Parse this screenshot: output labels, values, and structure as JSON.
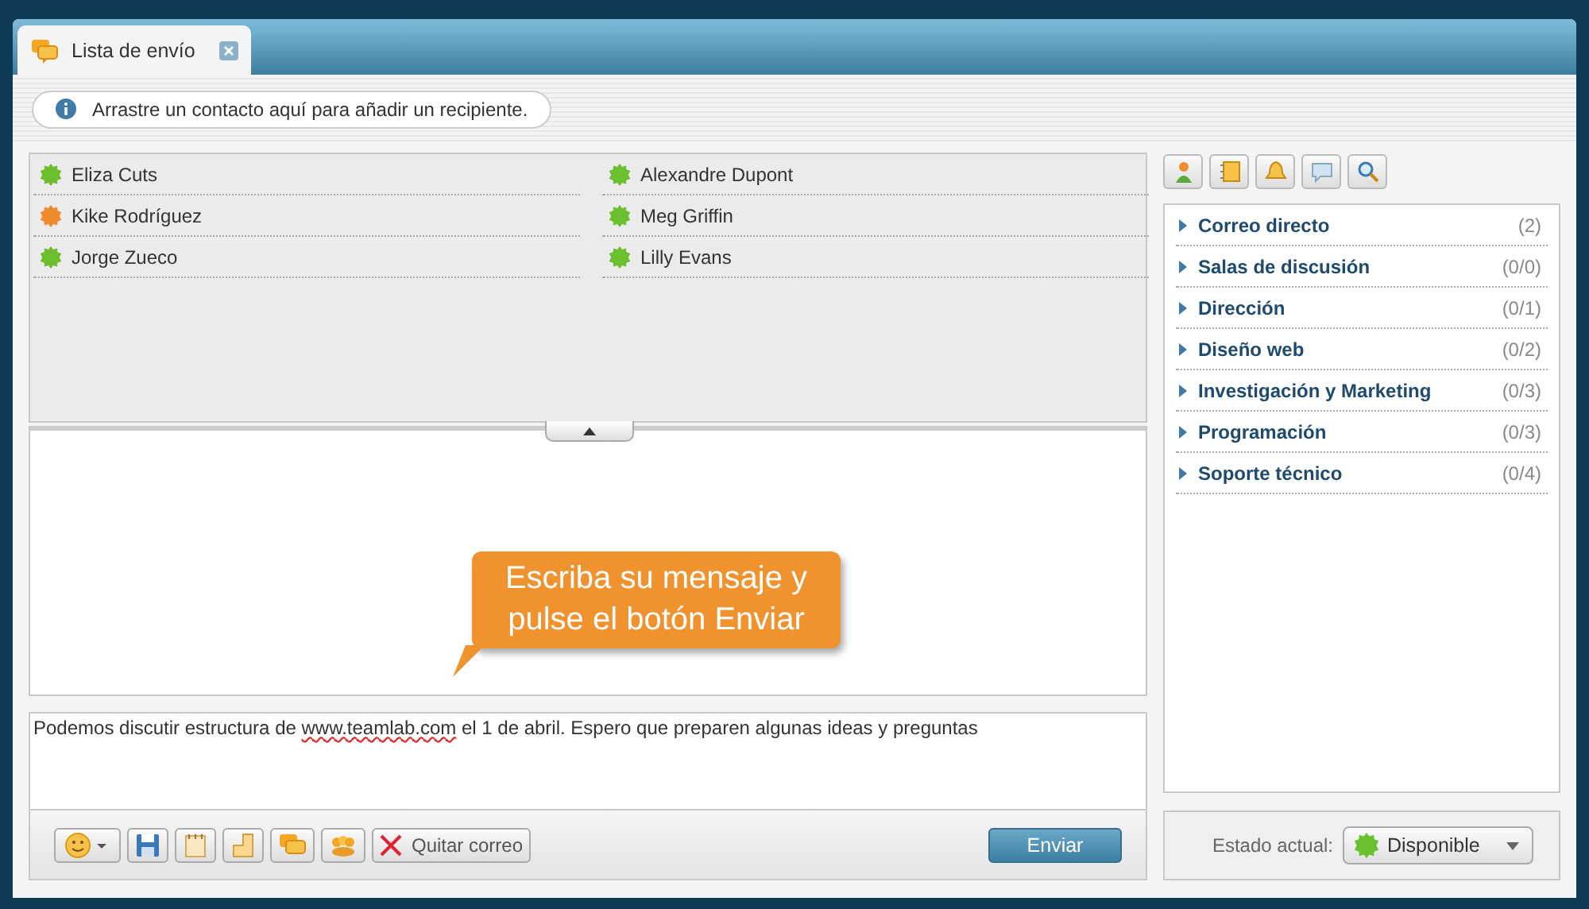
{
  "tab": {
    "label": "Lista de envío",
    "selected": true
  },
  "info": "Arrastre un contacto aquí para añadir un recipiente.",
  "contacts": [
    {
      "name": "Eliza Cuts",
      "color": "#6cbf2e"
    },
    {
      "name": "Alexandre Dupont",
      "color": "#6cbf2e"
    },
    {
      "name": "Kike Rodríguez",
      "color": "#f08a2c"
    },
    {
      "name": "Meg Griffin",
      "color": "#6cbf2e"
    },
    {
      "name": "Jorge Zueco",
      "color": "#6cbf2e"
    },
    {
      "name": "Lilly Evans",
      "color": "#6cbf2e"
    }
  ],
  "callout": "Escriba su mensaje y pulse el botón Enviar",
  "message": {
    "before": "Podemos discutir estructura de ",
    "link": "www.teamlab.com",
    "after": " el 1 de abril. Espero que preparen algunas ideas y preguntas"
  },
  "toolbar": {
    "remove_button": "Quitar correo",
    "send_button": "Enviar"
  },
  "groups": [
    {
      "name": "Correo directo",
      "count": "(2)"
    },
    {
      "name": "Salas de discusión",
      "count": "(0/0)"
    },
    {
      "name": "Dirección",
      "count": "(0/1)"
    },
    {
      "name": "Diseño web",
      "count": "(0/2)"
    },
    {
      "name": "Investigación y Marketing",
      "count": "(0/3)"
    },
    {
      "name": "Programación",
      "count": "(0/3)"
    },
    {
      "name": "Soporte técnico",
      "count": "(0/4)"
    }
  ],
  "status": {
    "label": "Estado actual:",
    "value": "Disponible",
    "color": "#6cbf2e"
  }
}
